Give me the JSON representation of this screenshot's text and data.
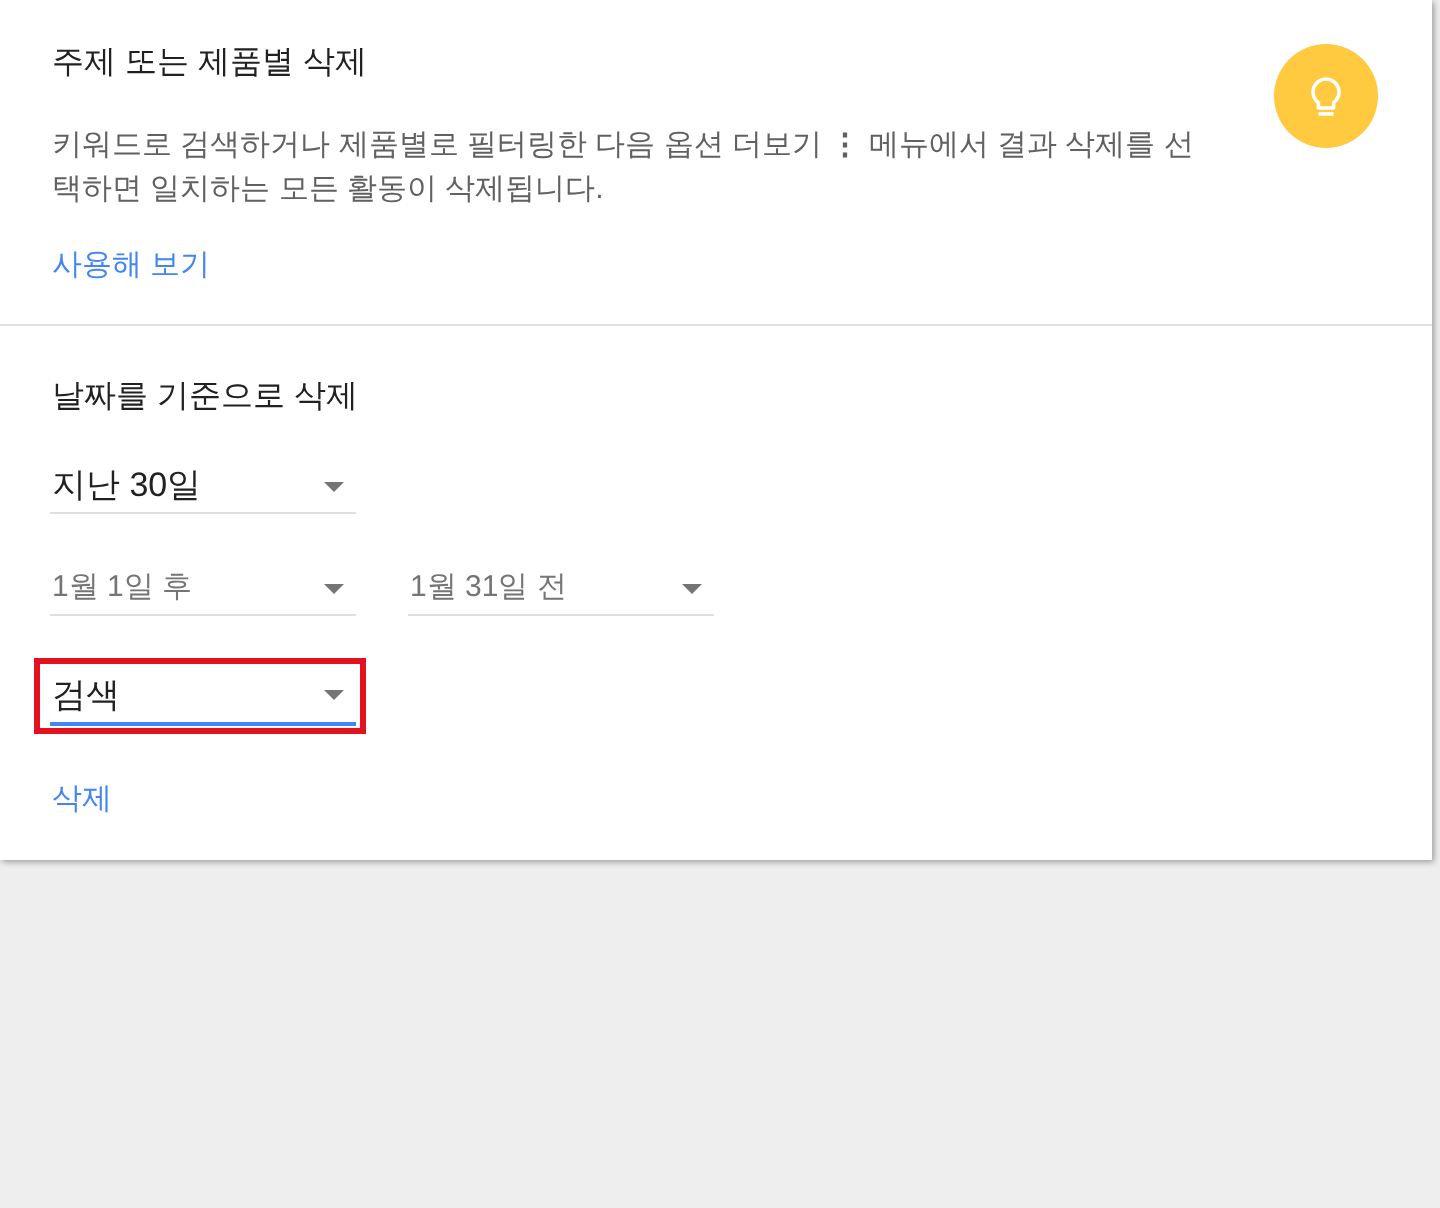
{
  "topic_section": {
    "title": "주제 또는 제품별 삭제",
    "description": "키워드로 검색하거나 제품별로 필터링한 다음 옵션 더보기 **⋮** 메뉴에서 결과 삭제를 선택하면 일치하는 모든 활동이 삭제됩니다.",
    "link": "사용해 보기"
  },
  "date_section": {
    "title": "날짜를 기준으로 삭제",
    "rows": [
      {
        "fields": [
          {
            "value": "지난 30일",
            "disabled": false,
            "focused": false,
            "highlighted": false
          }
        ]
      },
      {
        "fields": [
          {
            "value": "1월 1일 후",
            "disabled": true,
            "focused": false,
            "highlighted": false
          },
          {
            "value": "1월 31일 전",
            "disabled": true,
            "focused": false,
            "highlighted": false
          }
        ]
      },
      {
        "fields": [
          {
            "value": "검색",
            "disabled": false,
            "focused": true,
            "highlighted": true
          }
        ]
      }
    ],
    "link": "삭제"
  }
}
